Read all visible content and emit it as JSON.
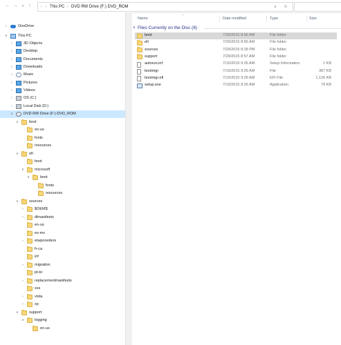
{
  "address": {
    "path": [
      {
        "label": "This PC"
      },
      {
        "label": "DVD RW Drive (F:) DVD_ROM"
      }
    ]
  },
  "columns": {
    "name": "Name",
    "date": "Date modified",
    "type": "Type",
    "size": "Size"
  },
  "group": {
    "title": "Files Currently on the Disc (8)"
  },
  "files": [
    {
      "name": "boot",
      "date": "7/29/2015 8:56 AM",
      "type": "File folder",
      "size": "",
      "icon": "folder-icon",
      "selected": true
    },
    {
      "name": "efi",
      "date": "7/29/2015 8:56 AM",
      "type": "File folder",
      "size": "",
      "icon": "folder-icon"
    },
    {
      "name": "sources",
      "date": "7/29/2015 8:28 PM",
      "type": "File folder",
      "size": "",
      "icon": "folder-icon"
    },
    {
      "name": "support",
      "date": "7/29/2015 8:57 AM",
      "type": "File folder",
      "size": "",
      "icon": "folder-icon"
    },
    {
      "name": "autorun.inf",
      "date": "7/10/2015 9:26 AM",
      "type": "Setup Information",
      "size": "1 KB",
      "icon": "settings-file-icon"
    },
    {
      "name": "bootmgr",
      "date": "7/10/2015 9:26 AM",
      "type": "File",
      "size": "387 KB",
      "icon": "file-icon"
    },
    {
      "name": "bootmgr.efi",
      "date": "7/10/2015 9:26 AM",
      "type": "EFI File",
      "size": "1,126 KB",
      "icon": "file-icon"
    },
    {
      "name": "setup.exe",
      "date": "7/10/2015 9:26 AM",
      "type": "Application",
      "size": "79 KB",
      "icon": "setup-app-icon"
    }
  ],
  "nav": [
    {
      "label": "OneDrive",
      "level": 0,
      "expand": "collapsed",
      "icon": "onedrive-icon"
    },
    {
      "label": "This PC",
      "level": 0,
      "expand": "expanded",
      "icon": "this-pc-icon"
    },
    {
      "label": "3D Objects",
      "level": 1,
      "expand": "collapsed",
      "icon": "3d-objects-icon"
    },
    {
      "label": "Desktop",
      "level": 1,
      "expand": "collapsed",
      "icon": "desktop-icon"
    },
    {
      "label": "Documents",
      "level": 1,
      "expand": "collapsed",
      "icon": "documents-icon"
    },
    {
      "label": "Downloads",
      "level": 1,
      "expand": "collapsed",
      "icon": "downloads-icon"
    },
    {
      "label": "Music",
      "level": 1,
      "expand": "collapsed",
      "icon": "music-icon"
    },
    {
      "label": "Pictures",
      "level": 1,
      "expand": "collapsed",
      "icon": "pictures-icon"
    },
    {
      "label": "Videos",
      "level": 1,
      "expand": "collapsed",
      "icon": "videos-icon"
    },
    {
      "label": "OS (C:)",
      "level": 1,
      "expand": "collapsed",
      "icon": "drive-icon"
    },
    {
      "label": "Local Disk (D:)",
      "level": 1,
      "expand": "collapsed",
      "icon": "drive-icon"
    },
    {
      "label": "DVD RW Drive (F:) DVD_ROM",
      "level": 1,
      "expand": "expanded",
      "icon": "dvd-icon",
      "selected": true
    },
    {
      "label": "boot",
      "level": 2,
      "expand": "expanded",
      "icon": "folder-icon"
    },
    {
      "label": "en-us",
      "level": 3,
      "expand": "none",
      "icon": "folder-icon"
    },
    {
      "label": "fonts",
      "level": 3,
      "expand": "none",
      "icon": "folder-icon"
    },
    {
      "label": "resources",
      "level": 3,
      "expand": "none",
      "icon": "folder-icon"
    },
    {
      "label": "efi",
      "level": 2,
      "expand": "expanded",
      "icon": "folder-icon"
    },
    {
      "label": "boot",
      "level": 3,
      "expand": "none",
      "icon": "folder-icon"
    },
    {
      "label": "microsoft",
      "level": 3,
      "expand": "expanded",
      "icon": "folder-icon"
    },
    {
      "label": "boot",
      "level": 4,
      "expand": "expanded",
      "icon": "folder-icon"
    },
    {
      "label": "fonts",
      "level": 5,
      "expand": "none",
      "icon": "folder-icon"
    },
    {
      "label": "resources",
      "level": 5,
      "expand": "none",
      "icon": "folder-icon"
    },
    {
      "label": "sources",
      "level": 2,
      "expand": "expanded",
      "icon": "folder-icon"
    },
    {
      "label": "$OEM$",
      "level": 3,
      "expand": "collapsed",
      "icon": "folder-icon"
    },
    {
      "label": "dlmanifests",
      "level": 3,
      "expand": "collapsed",
      "icon": "folder-icon"
    },
    {
      "label": "en-us",
      "level": 3,
      "expand": "none",
      "icon": "folder-icon"
    },
    {
      "label": "es-mx",
      "level": 3,
      "expand": "none",
      "icon": "folder-icon"
    },
    {
      "label": "etwproviders",
      "level": 3,
      "expand": "collapsed",
      "icon": "folder-icon"
    },
    {
      "label": "fr-ca",
      "level": 3,
      "expand": "none",
      "icon": "folder-icon"
    },
    {
      "label": "inf",
      "level": 3,
      "expand": "none",
      "icon": "folder-icon"
    },
    {
      "label": "migration",
      "level": 3,
      "expand": "collapsed",
      "icon": "folder-icon"
    },
    {
      "label": "pt-br",
      "level": 3,
      "expand": "none",
      "icon": "folder-icon"
    },
    {
      "label": "replacementmanifests",
      "level": 3,
      "expand": "collapsed",
      "icon": "folder-icon"
    },
    {
      "label": "sxs",
      "level": 3,
      "expand": "none",
      "icon": "folder-icon"
    },
    {
      "label": "vista",
      "level": 3,
      "expand": "collapsed",
      "icon": "folder-icon"
    },
    {
      "label": "xp",
      "level": 3,
      "expand": "collapsed",
      "icon": "folder-icon"
    },
    {
      "label": "support",
      "level": 2,
      "expand": "expanded",
      "icon": "folder-icon"
    },
    {
      "label": "logging",
      "level": 3,
      "expand": "expanded",
      "icon": "folder-icon"
    },
    {
      "label": "en-us",
      "level": 4,
      "expand": "none",
      "icon": "folder-icon"
    }
  ]
}
